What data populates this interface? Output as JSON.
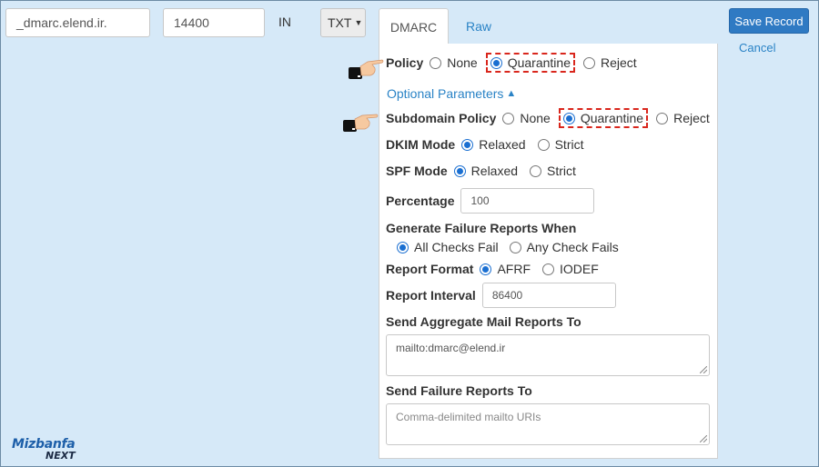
{
  "record": {
    "name_value": "_dmarc.elend.ir.",
    "ttl_value": "14400",
    "class_label": "IN",
    "type_value": "TXT"
  },
  "tabs": [
    {
      "label": "DMARC",
      "active": true
    },
    {
      "label": "Raw",
      "active": false
    }
  ],
  "actions": {
    "save_label": "Save Record",
    "cancel_label": "Cancel"
  },
  "form": {
    "policy": {
      "label": "Policy",
      "options": [
        "None",
        "Quarantine",
        "Reject"
      ],
      "selected": "Quarantine"
    },
    "optional_toggle_label": "Optional Parameters",
    "subdomain_policy": {
      "label": "Subdomain Policy",
      "options": [
        "None",
        "Quarantine",
        "Reject"
      ],
      "selected": "Quarantine"
    },
    "dkim_mode": {
      "label": "DKIM Mode",
      "options": [
        "Relaxed",
        "Strict"
      ],
      "selected": "Relaxed"
    },
    "spf_mode": {
      "label": "SPF Mode",
      "options": [
        "Relaxed",
        "Strict"
      ],
      "selected": "Relaxed"
    },
    "percentage": {
      "label": "Percentage",
      "value": "100"
    },
    "failure_reports_when": {
      "label": "Generate Failure Reports When",
      "options": [
        "All Checks Fail",
        "Any Check Fails"
      ],
      "selected": "All Checks Fail"
    },
    "report_format": {
      "label": "Report Format",
      "options": [
        "AFRF",
        "IODEF"
      ],
      "selected": "AFRF"
    },
    "report_interval": {
      "label": "Report Interval",
      "value": "86400"
    },
    "aggregate_reports": {
      "label": "Send Aggregate Mail Reports To",
      "value": "mailto:dmarc@elend.ir"
    },
    "failure_reports": {
      "label": "Send Failure Reports To",
      "placeholder": "Comma-delimited mailto URIs"
    }
  },
  "colors": {
    "background": "#d6e9f8",
    "accent": "#2f7ac3",
    "link": "#2a83c6",
    "highlight": "#d9261c"
  },
  "icons": [
    "pointing-hand-icon",
    "caret-up-icon",
    "chevron-down-icon"
  ],
  "logo": {
    "main": "Mizbanfa",
    "sub": "NEXT"
  }
}
